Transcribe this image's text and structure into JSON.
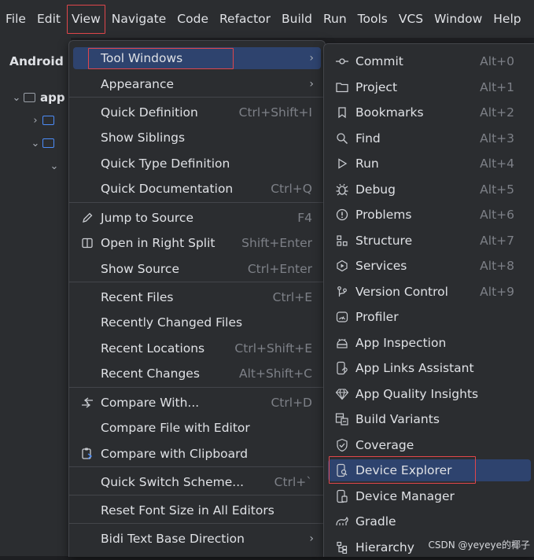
{
  "menubar": {
    "items": [
      "File",
      "Edit",
      "View",
      "Navigate",
      "Code",
      "Refactor",
      "Build",
      "Run",
      "Tools",
      "VCS",
      "Window",
      "Help"
    ],
    "active": "View"
  },
  "project_pane": {
    "title": "Android",
    "root_label": "app"
  },
  "view_menu": {
    "items": [
      {
        "label": "Tool Windows",
        "shortcut": "",
        "submenu": true
      },
      {
        "label": "Appearance",
        "shortcut": "",
        "submenu": true
      },
      {
        "label": "Quick Definition",
        "shortcut": "Ctrl+Shift+I"
      },
      {
        "label": "Show Siblings",
        "shortcut": ""
      },
      {
        "label": "Quick Type Definition",
        "shortcut": ""
      },
      {
        "label": "Quick Documentation",
        "shortcut": "Ctrl+Q"
      },
      {
        "label": "Jump to Source",
        "shortcut": "F4",
        "icon": "pencil-icon"
      },
      {
        "label": "Open in Right Split",
        "shortcut": "Shift+Enter",
        "icon": "split-icon"
      },
      {
        "label": "Show Source",
        "shortcut": "Ctrl+Enter"
      },
      {
        "label": "Recent Files",
        "shortcut": "Ctrl+E"
      },
      {
        "label": "Recently Changed Files",
        "shortcut": ""
      },
      {
        "label": "Recent Locations",
        "shortcut": "Ctrl+Shift+E"
      },
      {
        "label": "Recent Changes",
        "shortcut": "Alt+Shift+C"
      },
      {
        "label": "Compare With...",
        "shortcut": "Ctrl+D",
        "icon": "compare-icon"
      },
      {
        "label": "Compare File with Editor",
        "shortcut": ""
      },
      {
        "label": "Compare with Clipboard",
        "shortcut": "",
        "icon": "clipboard-icon"
      },
      {
        "label": "Quick Switch Scheme...",
        "shortcut": "Ctrl+`"
      },
      {
        "label": "Reset Font Size in All Editors",
        "shortcut": ""
      },
      {
        "label": "Bidi Text Base Direction",
        "shortcut": "",
        "submenu": true
      }
    ]
  },
  "tool_windows_menu": {
    "items": [
      {
        "label": "Commit",
        "shortcut": "Alt+0",
        "icon": "commit-icon"
      },
      {
        "label": "Project",
        "shortcut": "Alt+1",
        "icon": "folder-icon"
      },
      {
        "label": "Bookmarks",
        "shortcut": "Alt+2",
        "icon": "bookmark-icon"
      },
      {
        "label": "Find",
        "shortcut": "Alt+3",
        "icon": "search-icon"
      },
      {
        "label": "Run",
        "shortcut": "Alt+4",
        "icon": "run-icon"
      },
      {
        "label": "Debug",
        "shortcut": "Alt+5",
        "icon": "bug-icon"
      },
      {
        "label": "Problems",
        "shortcut": "Alt+6",
        "icon": "problems-icon"
      },
      {
        "label": "Structure",
        "shortcut": "Alt+7",
        "icon": "structure-icon"
      },
      {
        "label": "Services",
        "shortcut": "Alt+8",
        "icon": "services-icon"
      },
      {
        "label": "Version Control",
        "shortcut": "Alt+9",
        "icon": "vcs-icon"
      },
      {
        "label": "Profiler",
        "shortcut": "",
        "icon": "profiler-icon"
      },
      {
        "label": "App Inspection",
        "shortcut": "",
        "icon": "inspection-icon"
      },
      {
        "label": "App Links Assistant",
        "shortcut": "",
        "icon": "links-icon"
      },
      {
        "label": "App Quality Insights",
        "shortcut": "",
        "icon": "diamond-icon"
      },
      {
        "label": "Build Variants",
        "shortcut": "",
        "icon": "build-variants-icon"
      },
      {
        "label": "Coverage",
        "shortcut": "",
        "icon": "shield-icon"
      },
      {
        "label": "Device Explorer",
        "shortcut": "",
        "icon": "device-explorer-icon"
      },
      {
        "label": "Device Manager",
        "shortcut": "",
        "icon": "device-manager-icon"
      },
      {
        "label": "Gradle",
        "shortcut": "",
        "icon": "gradle-icon"
      },
      {
        "label": "Hierarchy",
        "shortcut": "",
        "icon": "hierarchy-icon"
      }
    ]
  },
  "watermark": "CSDN @yeyeye的椰子",
  "colors": {
    "highlight": "#2e436e",
    "annotation_red": "#e0464b",
    "folder_blue": "#4c8cf8"
  }
}
